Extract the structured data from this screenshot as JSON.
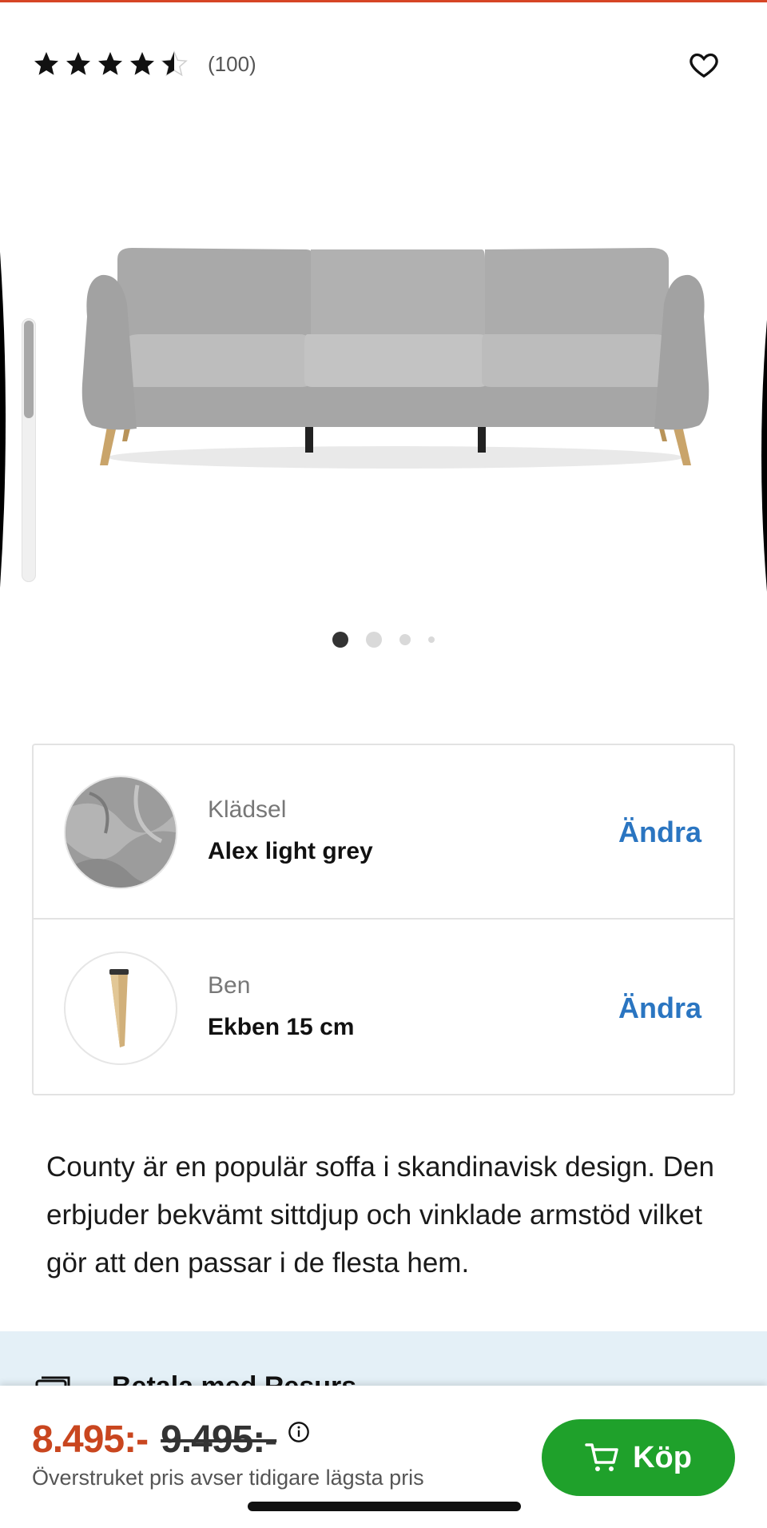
{
  "colors": {
    "accent": "#d64525",
    "price": "#c9461f",
    "link": "#2a75c1",
    "buy": "#1fa12b",
    "banner": "#e4f0f7"
  },
  "rating": {
    "stars": 4.5,
    "max_stars": 5,
    "count_text": "(100)"
  },
  "gallery": {
    "total_images": 4,
    "active_index": 0
  },
  "options": [
    {
      "label": "Klädsel",
      "value": "Alex light grey",
      "action": "Ändra",
      "icon": "fabric-swatch"
    },
    {
      "label": "Ben",
      "value": "Ekben 15 cm",
      "action": "Ändra",
      "icon": "oak-leg"
    }
  ],
  "description": "County är en populär soffa i skandinavisk design. Den erbjuder bekvämt sittdjup och vinklade armstöd vilket gör att den passar i de flesta hem.",
  "payment": {
    "text": "Betala med Resurs",
    "icon": "card-icon"
  },
  "purchase": {
    "price": "8.495:-",
    "old_price": "9.495:-",
    "note": "Överstruket pris avser tidigare lägsta pris",
    "buy_label": "Köp",
    "icons": {
      "info": "info-icon",
      "cart": "cart-icon",
      "favorite": "heart-icon"
    }
  }
}
